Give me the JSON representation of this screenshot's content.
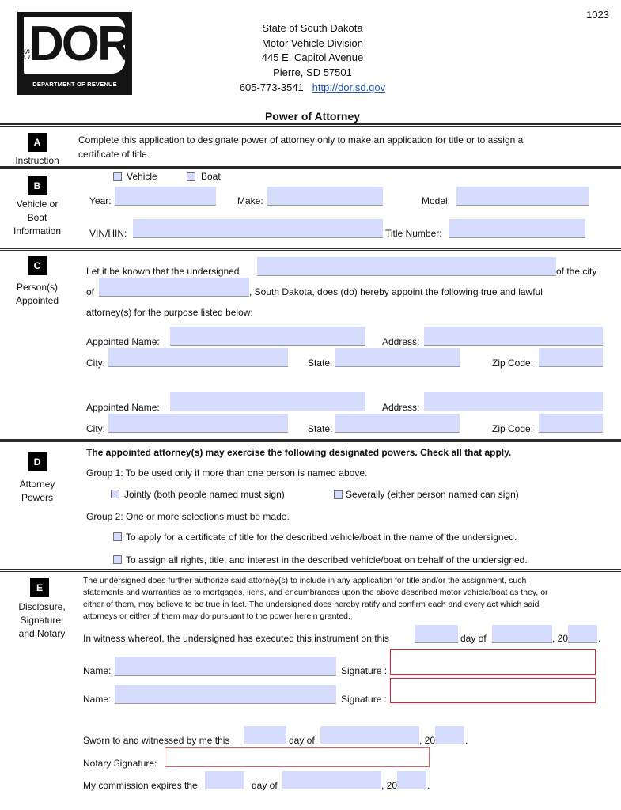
{
  "form_number": "1023",
  "logo": {
    "letters": "DOR",
    "state_abbr": "SD",
    "caption": "DEPARTMENT OF REVENUE"
  },
  "header": {
    "line1": "State of South Dakota",
    "line2": "Motor Vehicle Division",
    "line3": "445 E. Capitol Avenue",
    "line4": "Pierre, SD 57501",
    "phone": "605-773-3541",
    "website": "http://dor.sd.gov",
    "title": "Power of Attorney"
  },
  "sections": {
    "a": {
      "letter": "A",
      "label": "Instruction",
      "text_line1": "Complete this application to designate power of attorney only to make an application for title or to assign a",
      "text_line2": "certificate of title."
    },
    "b": {
      "letter": "B",
      "label_lines": [
        "Vehicle or",
        "Boat",
        "Information"
      ],
      "checkbox_vehicle": "Vehicle",
      "checkbox_boat": "Boat",
      "year_label": "Year:",
      "make_label": "Make:",
      "model_label": "Model:",
      "vin_label": "VIN/HIN:",
      "title_number_label": "Title Number:",
      "values": {
        "year": "",
        "make": "",
        "model": "",
        "vin": "",
        "title_number": ""
      }
    },
    "c": {
      "letter": "C",
      "label_lines": [
        "Person(s)",
        "Appointed"
      ],
      "intro_prefix": "Let it be known that the undersigned",
      "intro_suffix": "of the city",
      "of_label": "of",
      "sd_text": ", South Dakota, does (do) hereby appoint the following true and lawful",
      "attorney_text": "attorney(s) for the purpose listed below:",
      "appointed_name_label": "Appointed Name:",
      "address_label": "Address:",
      "city_label": "City:",
      "state_label": "State:",
      "zip_label": "Zip Code:",
      "values": {
        "undersigned": "",
        "city_of": "",
        "appointee1": {
          "name": "",
          "address": "",
          "city": "",
          "state": "",
          "zip": ""
        },
        "appointee2": {
          "name": "",
          "address": "",
          "city": "",
          "state": "",
          "zip": ""
        }
      }
    },
    "d": {
      "letter": "D",
      "label_lines": [
        "Attorney",
        "Powers"
      ],
      "heading": "The appointed attorney(s) may exercise the following designated powers. Check all that apply.",
      "group1": "Group 1: To be used only if more than one person is named above.",
      "jointly": "Jointly (both people named must sign)",
      "severally": "Severally (either person named can sign)",
      "group2": "Group 2: One or more selections must be made.",
      "apply_title": "To apply for a certificate of title for the described vehicle/boat in the name of the undersigned.",
      "assign_rights": "To assign all rights, title, and interest in the described vehicle/boat on behalf of the undersigned."
    },
    "e": {
      "letter": "E",
      "label_lines": [
        "Disclosure,",
        "Signature,",
        "and Notary"
      ],
      "para_lines": [
        "The undersigned does further authorize said attorney(s) to include in any application for title and/or the assignment, such",
        "statements and warranties as to mortgages, liens, and encumbrances upon the above described motor vehicle/boat as they, or",
        "either of them, may believe to be true in fact. The undersigned does hereby ratify and confirm each and every act which said",
        "attorneys or either of them may do pursuant to the power herein granted."
      ],
      "witness_prefix": "In witness whereof, the undersigned has executed this instrument on this",
      "day_of": "day of",
      "comma_20": ", 20",
      "period": ".",
      "name_label": "Name:",
      "signature_label": "Signature :",
      "sworn_prefix": "Sworn to and witnessed by me this",
      "notary_label": "Notary Signature:",
      "commission_prefix": "My commission expires the",
      "values": {
        "witness_day": "",
        "witness_month": "",
        "witness_year": "",
        "name1": "",
        "name2": "",
        "sworn_day": "",
        "sworn_month": "",
        "sworn_year": "",
        "commission_day": "",
        "commission_month": "",
        "commission_year": ""
      }
    }
  },
  "colors": {
    "field_fill": "#d6dcfd",
    "signature_border": "#e0212b",
    "link": "#1f55b8"
  }
}
